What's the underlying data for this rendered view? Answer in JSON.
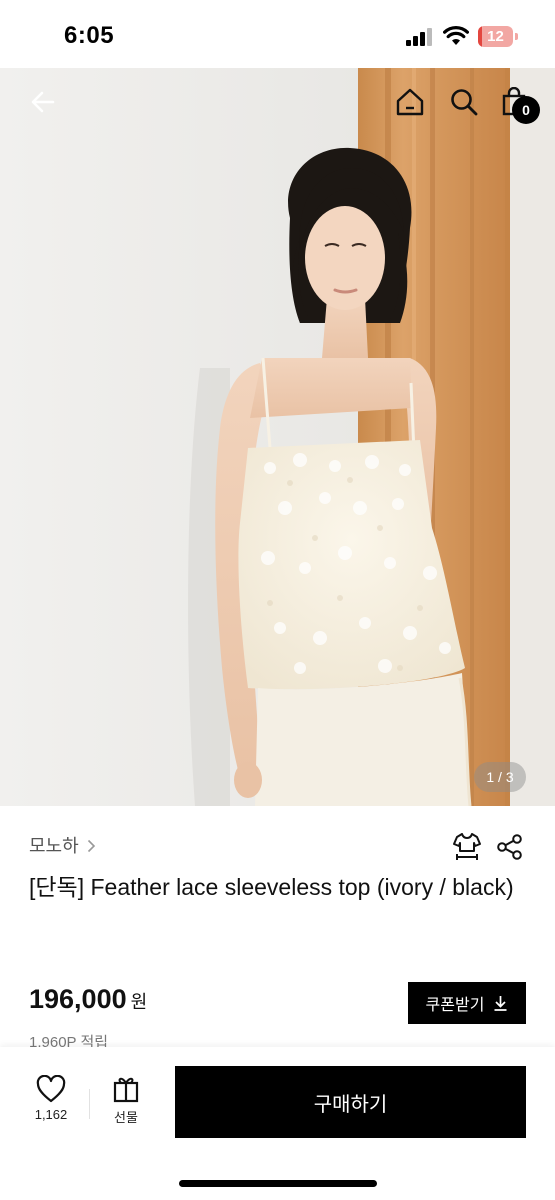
{
  "status_bar": {
    "time": "6:05",
    "battery_level": "12",
    "battery_fraction": 0.12,
    "battery_color": "#e3463f"
  },
  "header": {
    "back_icon": "arrow-left-icon",
    "home_icon": "home-icon",
    "search_icon": "search-icon",
    "cart_icon": "shopping-bag-icon",
    "cart_count": "0"
  },
  "gallery": {
    "page_indicator": "1 / 3",
    "current_page": 1,
    "total_pages": 3
  },
  "product": {
    "brand": "모노하",
    "title": "[단독] Feather lace sleeveless top (ivory / black)",
    "price": "196,000",
    "currency": "원",
    "points": "1,960P 적립",
    "coupon_label": "쿠폰받기",
    "size_icon": "clothing-size-icon",
    "share_icon": "share-icon"
  },
  "bottom_bar": {
    "like_count": "1,162",
    "gift_label": "선물",
    "buy_label": "구매하기",
    "accent": "#000000"
  }
}
